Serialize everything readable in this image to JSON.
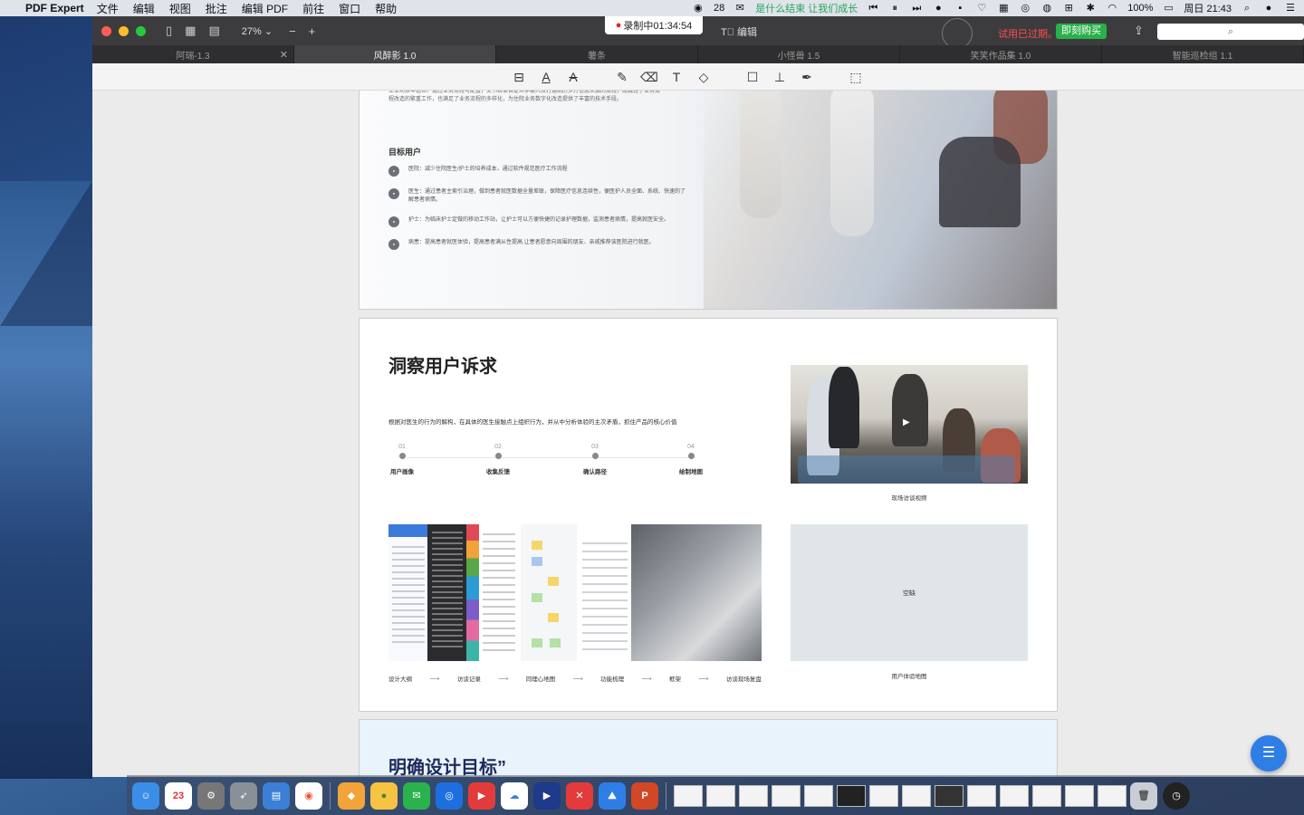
{
  "menubar": {
    "app_name": "PDF Expert",
    "menus": [
      "文件",
      "编辑",
      "视图",
      "批注",
      "编辑 PDF",
      "前往",
      "窗口",
      "帮助"
    ],
    "badge_count": "28",
    "status_text": "是什么结束 让我们成长",
    "battery": "100%",
    "clock": "周日 21:43"
  },
  "window": {
    "zoom": "27%",
    "recording": "录制中01:34:54",
    "edit_mode": "编辑",
    "trial_text": "试用已过期。",
    "buy_label": "即刻购买",
    "tabs": [
      "阿瑞-1.3",
      "风醉影 1.0",
      "薯条",
      "小怪兽 1.5",
      "笑笑作品集 1.0",
      "智能巡检组 1.1"
    ]
  },
  "page1": {
    "intro": "工业场景中巡检、通过业务流程可配置，文书表单自定义手输入及打通病历多方信息来源的流程，既减轻了业务流程改造的繁重工作，也满足了业务流程的多样化，为住院业务数字化改造提供了丰富的技术手段。",
    "section_title": "目标用户",
    "items": [
      "医院：减少住院医生/护士的培养成本，通过软件规范医疗工作流程",
      "医生：通过患者主索引治理，做到患者就医数据全量差联，保障医疗信息连续性，便医护人员全面、系统、快速的了解患者病情。",
      "护士：为临床护士定做的移动工作站，让护士可以方便快捷的记录护理数据，监测患者病情，提高就医安全。",
      "病患：提高患者就医体验，提高患者满从性提高.让患者愿意向周围的朋友、亲戚推荐该医院进行就医。"
    ]
  },
  "page2": {
    "title": "洞察用户诉求",
    "description": "根据对医生的行为的解构，在具体的医生接触点上组织行为，并从中分析体验的主次矛盾，抓住产品的核心价值",
    "steps": [
      {
        "num": "01",
        "label": "用户画像"
      },
      {
        "num": "02",
        "label": "收集反馈"
      },
      {
        "num": "03",
        "label": "确认路径"
      },
      {
        "num": "04",
        "label": "绘制地图"
      }
    ],
    "photo_caption": "现场访谈视频",
    "flow": [
      "设计大纲",
      "访谈记录",
      "同理心地图",
      "功能梳理",
      "框架",
      "访谈现场复盘"
    ],
    "empty_label": "空缺",
    "empty_caption": "用户体验地图"
  },
  "page3": {
    "title": "明确设计目标”"
  },
  "dock": {
    "calendar_day": "23"
  }
}
